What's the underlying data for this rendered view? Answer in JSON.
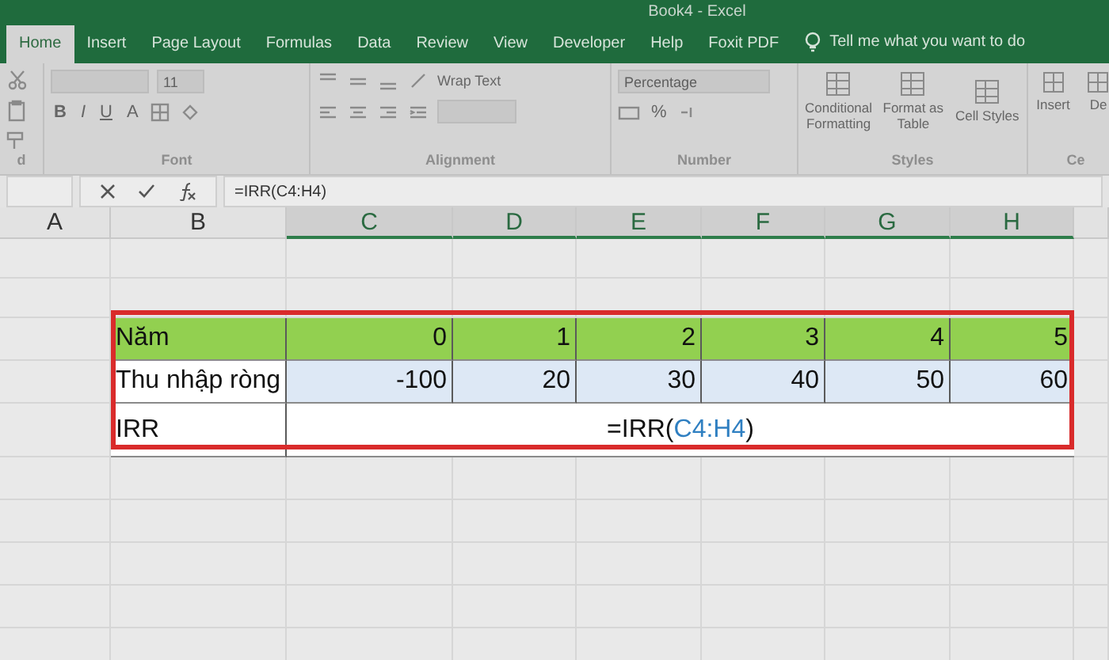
{
  "window": {
    "title": "Book4 - Excel"
  },
  "tabs": [
    {
      "label": "Home",
      "selected": true
    },
    {
      "label": "Insert",
      "selected": false
    },
    {
      "label": "Page Layout",
      "selected": false
    },
    {
      "label": "Formulas",
      "selected": false
    },
    {
      "label": "Data",
      "selected": false
    },
    {
      "label": "Review",
      "selected": false
    },
    {
      "label": "View",
      "selected": false
    },
    {
      "label": "Developer",
      "selected": false
    },
    {
      "label": "Help",
      "selected": false
    },
    {
      "label": "Foxit PDF",
      "selected": false
    }
  ],
  "tell_me": "Tell me what you want to do",
  "ribbon": [
    {
      "kind": "clipboard",
      "label": "d"
    },
    {
      "kind": "font",
      "label": "Font",
      "size": "11",
      "buttons": [
        "B",
        "I",
        "U",
        "A"
      ]
    },
    {
      "kind": "alignment",
      "label": "Alignment",
      "wrap": "Wrap Text"
    },
    {
      "kind": "number",
      "label": "Number",
      "format": "Percentage",
      "percent": "%"
    },
    {
      "kind": "styles",
      "label": "Styles",
      "buttons": [
        "Conditional Formatting",
        "Format as Table",
        "Cell Styles"
      ]
    },
    {
      "kind": "cells",
      "label": "Ce",
      "buttons": [
        "Insert",
        "De"
      ]
    }
  ],
  "formula_bar": {
    "formula": "=IRR(C4:H4)"
  },
  "columns": [
    {
      "label": "A",
      "selected": false
    },
    {
      "label": "B",
      "selected": false
    },
    {
      "label": "C",
      "selected": true
    },
    {
      "label": "D",
      "selected": true
    },
    {
      "label": "E",
      "selected": true
    },
    {
      "label": "F",
      "selected": true
    },
    {
      "label": "G",
      "selected": true
    },
    {
      "label": "H",
      "selected": true
    }
  ],
  "rows": [
    {
      "kind": "header",
      "cells": [
        "Năm",
        "0",
        "1",
        "2",
        "3",
        "4",
        "5"
      ]
    },
    {
      "kind": "selected",
      "cells": [
        "Thu nhập ròng",
        "-100",
        "20",
        "30",
        "40",
        "50",
        "60"
      ]
    },
    {
      "kind": "formula",
      "label": "IRR",
      "formula": [
        {
          "kind": "plain",
          "text": "=IRR("
        },
        {
          "kind": "ref",
          "text": "C4:H4"
        },
        {
          "kind": "plain",
          "text": ")"
        }
      ]
    }
  ]
}
